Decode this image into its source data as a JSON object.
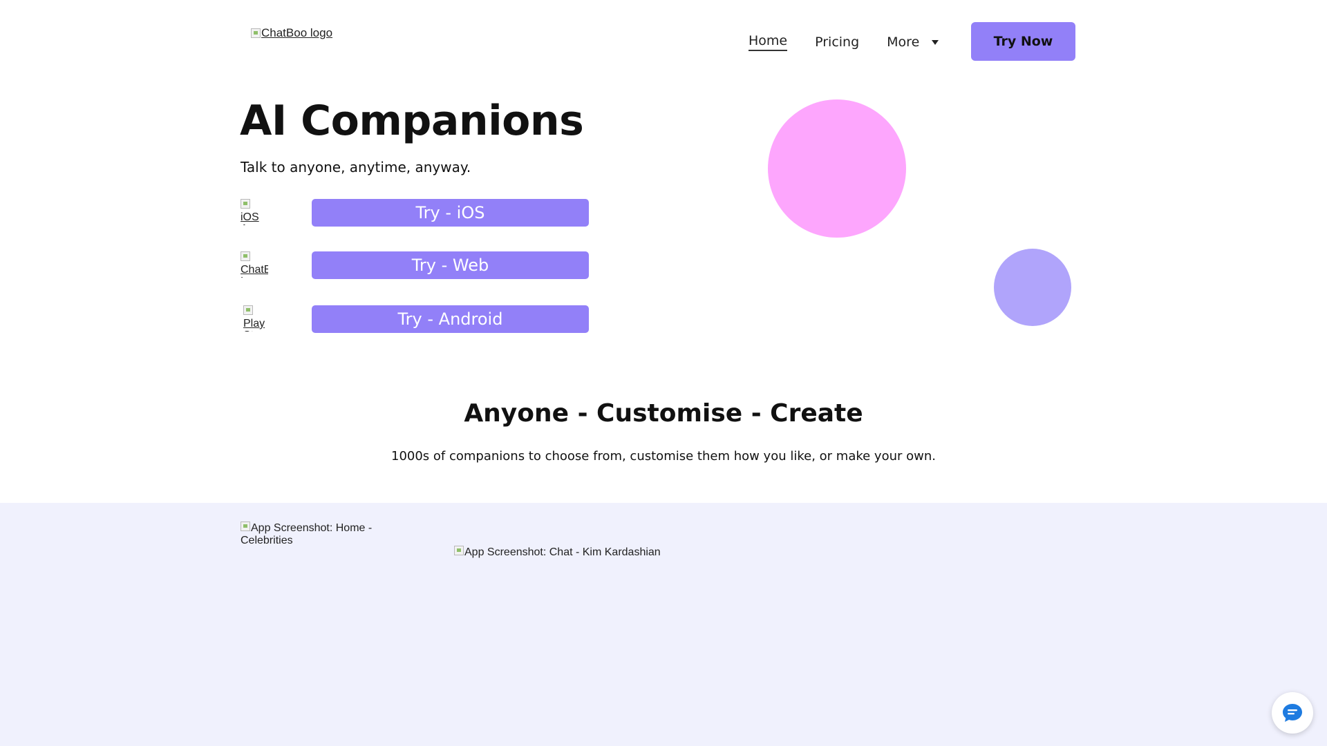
{
  "header": {
    "logo_alt": "ChatBoo logo",
    "nav": {
      "home": "Home",
      "pricing": "Pricing",
      "more": "More"
    },
    "try_now": "Try Now"
  },
  "hero": {
    "title": "AI Companions",
    "subtitle": "Talk to anyone, anytime, anyway.",
    "ctas": [
      {
        "icon_alt": "iOS A",
        "label": "Try - iOS"
      },
      {
        "icon_alt": "ChatBoo Logo",
        "label": "Try - Web"
      },
      {
        "icon_alt": "Play St",
        "label": "Try - Android"
      }
    ]
  },
  "section": {
    "title": "Anyone - Customise - Create",
    "subtitle": "1000s of companions to choose from, customise them how you like, or make your own."
  },
  "screenshots": {
    "home_alt": "App Screenshot: Home - Celebrities",
    "chat_alt": "App Screenshot: Chat - Kim Kardashian"
  },
  "colors": {
    "accent": "#9280f8",
    "pink_circle": "#fda6fd",
    "purple_circle": "#b0a4fb",
    "band_bg": "#f0f1fd",
    "chat_icon": "#1e7be0"
  },
  "icons": {
    "chat_widget": "chat-bubble-icon",
    "more_dropdown": "chevron-down-icon"
  }
}
